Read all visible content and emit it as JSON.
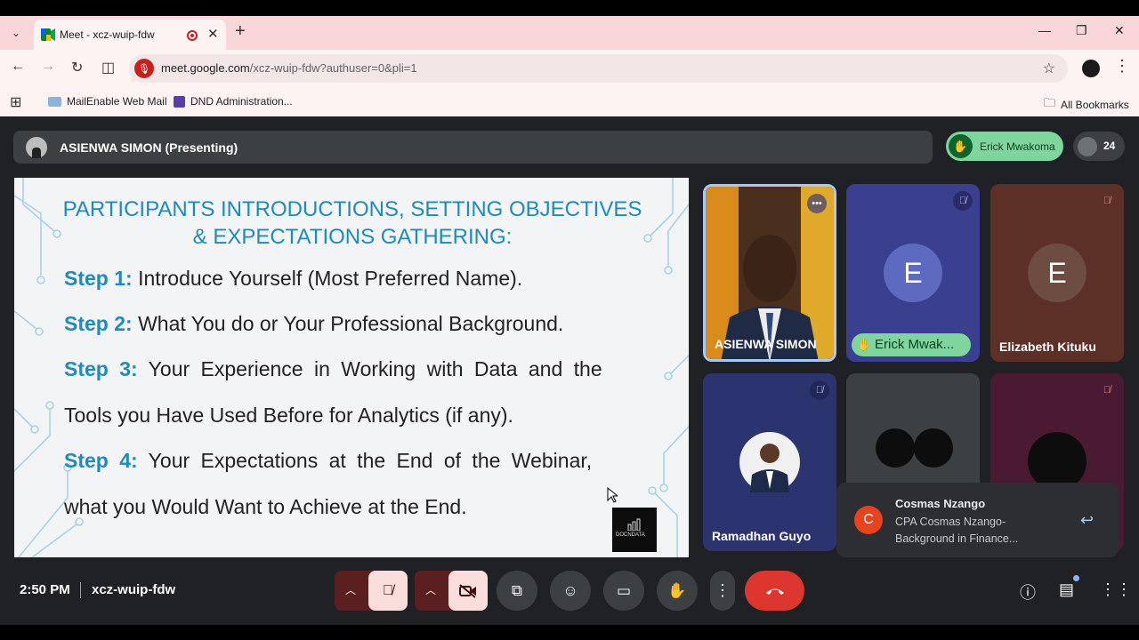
{
  "browser": {
    "tab_title": "Meet - xcz-wuip-fdw",
    "tab_close": "✕",
    "new_tab": "+",
    "url_host": "meet.google.com",
    "url_path": "/xcz-wuip-fdw?authuser=0&pli=1",
    "bookmarks": [
      {
        "label": "MailEnable Web Mail"
      },
      {
        "label": "DND Administration..."
      }
    ],
    "all_bookmarks": "All Bookmarks"
  },
  "meet": {
    "presenter_label": "ASIENWA SIMON (Presenting)",
    "raised_hand_name": "Erick Mwakoma",
    "participant_count": "24",
    "slide": {
      "title_line1": "PARTICIPANTS INTRODUCTIONS, SETTING OBJECTIVES",
      "title_line2": "& EXPECTATIONS GATHERING:",
      "steps": [
        {
          "label": "Step 1:",
          "text": "Introduce Yourself (Most Preferred Name)."
        },
        {
          "label": "Step 2:",
          "text": "What You do or Your Professional Background."
        },
        {
          "label": "Step 3:",
          "text": "Your Experience in Working with Data and the",
          "cont": "Tools you Have Used Before for Analytics (if any)."
        },
        {
          "label": "Step 4:",
          "text": "Your Expectations at the End of the Webinar,",
          "cont": "what you Would Want to Achieve at the End."
        }
      ],
      "logo_text": "DOCNDATA"
    },
    "tiles": [
      {
        "name": "ASIENWA SIMON"
      },
      {
        "name": "Erick Mwak...",
        "initial": "E",
        "avatar_color": "#5c6bc0"
      },
      {
        "name": "Elizabeth Kituku",
        "initial": "E",
        "avatar_color": "#6d4c41"
      },
      {
        "name": "Ramadhan Guyo"
      },
      {
        "name": ""
      },
      {
        "name": ""
      }
    ],
    "toast": {
      "initial": "C",
      "name": "Cosmas Nzango",
      "message_line1": "CPA Cosmas Nzango-",
      "message_line2": "Background in Finance..."
    },
    "controls": {
      "time": "2:50 PM",
      "meeting_code": "xcz-wuip-fdw"
    }
  },
  "colors": {
    "accent_blue": "#1d8bbd",
    "raise_green": "#7ed69e",
    "end_call_red": "#dc362e"
  }
}
